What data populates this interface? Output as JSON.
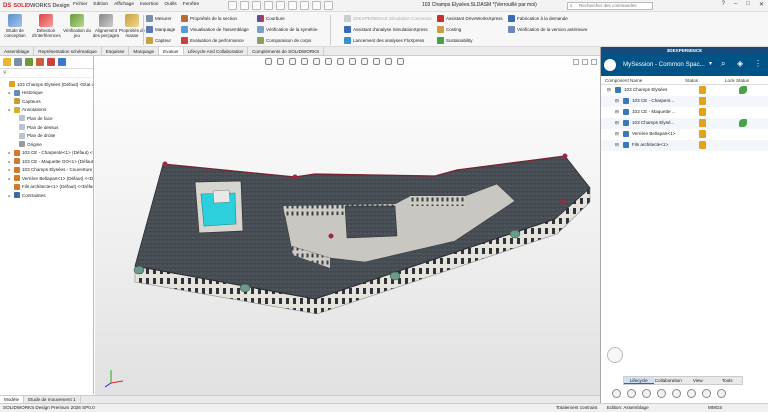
{
  "brand": {
    "ds": "DS",
    "solid": "SOLID",
    "works": "WORKS Design"
  },
  "menus": [
    "Fichier",
    "Edition",
    "Affichage",
    "Insertion",
    "Outils",
    "Fenêtre"
  ],
  "document_title": "103 Champs Elysées.SLDASM *(Verrouillé par moi)",
  "search_placeholder": "Rechercher des commandes",
  "ribbon": {
    "big_buttons": [
      {
        "label": "Etude de conception",
        "icon": "design-study-icon"
      },
      {
        "label": "Détection d'interférences",
        "icon": "interference-icon"
      },
      {
        "label": "Vérification du jeu",
        "icon": "clearance-icon"
      },
      {
        "label": "Alignement des perçages",
        "icon": "hole-alignment-icon"
      },
      {
        "label": "Propriétés de masse",
        "icon": "mass-properties-icon"
      }
    ],
    "col1": [
      "Mesurer",
      "Marquage",
      "Capteur"
    ],
    "col2": [
      "Propriétés de la section",
      "Visualisation de l'assemblage",
      "Evaluation de performance"
    ],
    "col3": [
      "Courbure",
      "Vérification de la symétrie",
      "Comparaison de corps"
    ],
    "col4": [
      "3DEXPERIENCE Simulation Connector",
      "Assistant d'analyse SimulationXpress",
      "Lancement des analyses FloXpress"
    ],
    "col5": [
      "Assistant DriveWorksXpress",
      "Costing",
      "Sustainability"
    ],
    "col6": [
      "Fabrication à la demande",
      "Vérification de la version antérieure"
    ]
  },
  "tabs": [
    "Assemblage",
    "Représentation schématique",
    "Esquisse",
    "Marquage",
    "Evaluer",
    "Lifecycle And Collaboration",
    "Compléments de SOLIDWORKS"
  ],
  "active_tab": "Evaluer",
  "tree": [
    {
      "label": "103 Champs Elysées (Défaut) <Etat d'affichage-1>",
      "level": 0,
      "tw": "",
      "color": "#e0a21a"
    },
    {
      "label": "Historique",
      "level": 1,
      "tw": "▸",
      "color": "#6a8ab8"
    },
    {
      "label": "Capteurs",
      "level": 1,
      "tw": "",
      "color": "#c2a041"
    },
    {
      "label": "Annotations",
      "level": 1,
      "tw": "▸",
      "color": "#d8b030"
    },
    {
      "label": "Plan de face",
      "level": 2,
      "tw": "",
      "color": "#b8c4d0"
    },
    {
      "label": "Plan de dessus",
      "level": 2,
      "tw": "",
      "color": "#b8c4d0"
    },
    {
      "label": "Plan de droite",
      "level": 2,
      "tw": "",
      "color": "#b8c4d0"
    },
    {
      "label": "Origine",
      "level": 2,
      "tw": "",
      "color": "#999999"
    },
    {
      "label": "103 CE - Charpente<1> (Défaut) <<Défaut>",
      "level": 1,
      "tw": "▸",
      "color": "#d07a2a"
    },
    {
      "label": "103 CE - Maquette GO<1> (Défaut) <<Défaut>",
      "level": 1,
      "tw": "▸",
      "color": "#d07a2a"
    },
    {
      "label": "103 Champs Elysées - Couverture Et Zinguerie",
      "level": 1,
      "tw": "▸",
      "color": "#d07a2a"
    },
    {
      "label": "Verrière Bellapart<1> (Défaut) <<Défaut>",
      "level": 1,
      "tw": "▸",
      "color": "#d07a2a"
    },
    {
      "label": "Fils architecte<1> (Défaut) <<Défaut>",
      "level": 1,
      "tw": "",
      "color": "#d07a2a"
    },
    {
      "label": "Contraintes",
      "level": 1,
      "tw": "▸",
      "color": "#3a6aa8"
    }
  ],
  "model_tabs": [
    "Modèle",
    "Etude de mouvement 1"
  ],
  "status": {
    "left": "SOLIDWORKS Design Premium 2026 SP0.0",
    "mid": "Totalement contraint",
    "edit": "Edition: Assemblage",
    "units": "MMGS"
  },
  "xp": {
    "title": "3DEXPERIENCE",
    "session": "MySession - Common Spac...",
    "columns": [
      "Component Name",
      "Status",
      "Lock Status"
    ],
    "rows": [
      {
        "name": "103 Champs Elysées",
        "indent": 0,
        "status_color": "#e3a21a",
        "lock_color": "#49a14a"
      },
      {
        "name": "103 CE - Charpent...",
        "indent": 1,
        "status_color": "#e3a21a",
        "lock_color": ""
      },
      {
        "name": "103 CE - Maquette ...",
        "indent": 1,
        "status_color": "#e3a21a",
        "lock_color": ""
      },
      {
        "name": "103 Champs Elysé...",
        "indent": 1,
        "status_color": "#e3a21a",
        "lock_color": "#49a14a"
      },
      {
        "name": "Verrière Bellapart<1>",
        "indent": 1,
        "status_color": "#e3a21a",
        "lock_color": ""
      },
      {
        "name": "Fils architecte<1>",
        "indent": 1,
        "status_color": "#e3a21a",
        "lock_color": ""
      }
    ],
    "bottom_tabs": [
      "Lifecycle",
      "Collaboration",
      "View",
      "Tools"
    ],
    "active_bottom": "Lifecycle"
  },
  "colors": {
    "accent": "#005386",
    "brand_red": "#d2232a",
    "roof": "#3f444a",
    "glass": "#2bd0dc"
  }
}
